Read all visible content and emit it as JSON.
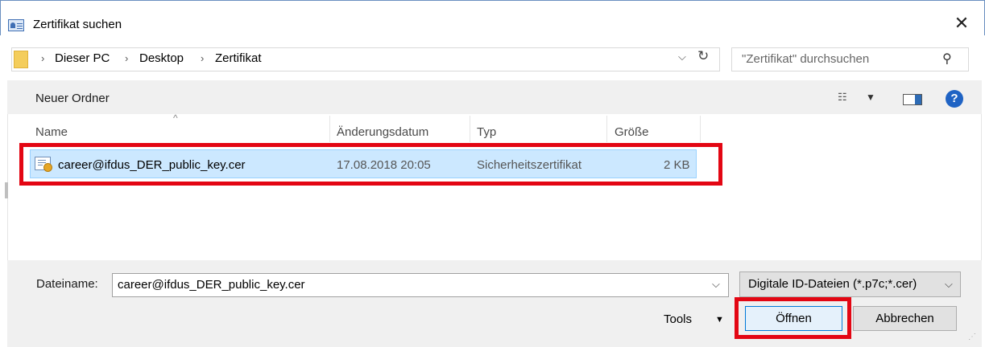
{
  "window": {
    "title": "Zertifikat suchen",
    "close": "✕"
  },
  "address": {
    "breadcrumbs": [
      "Dieser PC",
      "Desktop",
      "Zertifikat"
    ],
    "separator": "›",
    "dropdown_glyph": "⌵",
    "refresh_glyph": "↻",
    "search_placeholder": "\"Zertifikat\" durchsuchen",
    "search_glyph": "⚲"
  },
  "toolbar": {
    "new_folder": "Neuer Ordner",
    "view_glyph": "☷",
    "view_dropdown_glyph": "▼",
    "help_glyph": "?"
  },
  "file_list": {
    "sort_glyph": "^",
    "columns": [
      "Name",
      "Änderungsdatum",
      "Typ",
      "Größe"
    ],
    "rows": [
      {
        "name": "career@ifdus_DER_public_key.cer",
        "date": "17.08.2018 20:05",
        "type": "Sicherheitszertifikat",
        "size": "2 KB",
        "selected": true
      }
    ]
  },
  "bottom": {
    "filename_label": "Dateiname:",
    "filename_value": "career@ifdus_DER_public_key.cer",
    "dropdown_glyph": "⌵",
    "filetype_value": "Digitale ID-Dateien (*.p7c;*.cer)",
    "tools_label": "Tools",
    "tools_caret": "▼",
    "open_button": "Öffnen",
    "cancel_button": "Abbrechen",
    "grip_glyph": "⋰"
  },
  "colors": {
    "highlight": "#e30613",
    "selection": "#cce8ff",
    "accent": "#0078d7"
  },
  "icons": [
    "app-icon",
    "close-icon",
    "folder-icon",
    "refresh-icon",
    "search-icon",
    "view-icon",
    "pane-icon",
    "help-icon",
    "certificate-icon"
  ]
}
